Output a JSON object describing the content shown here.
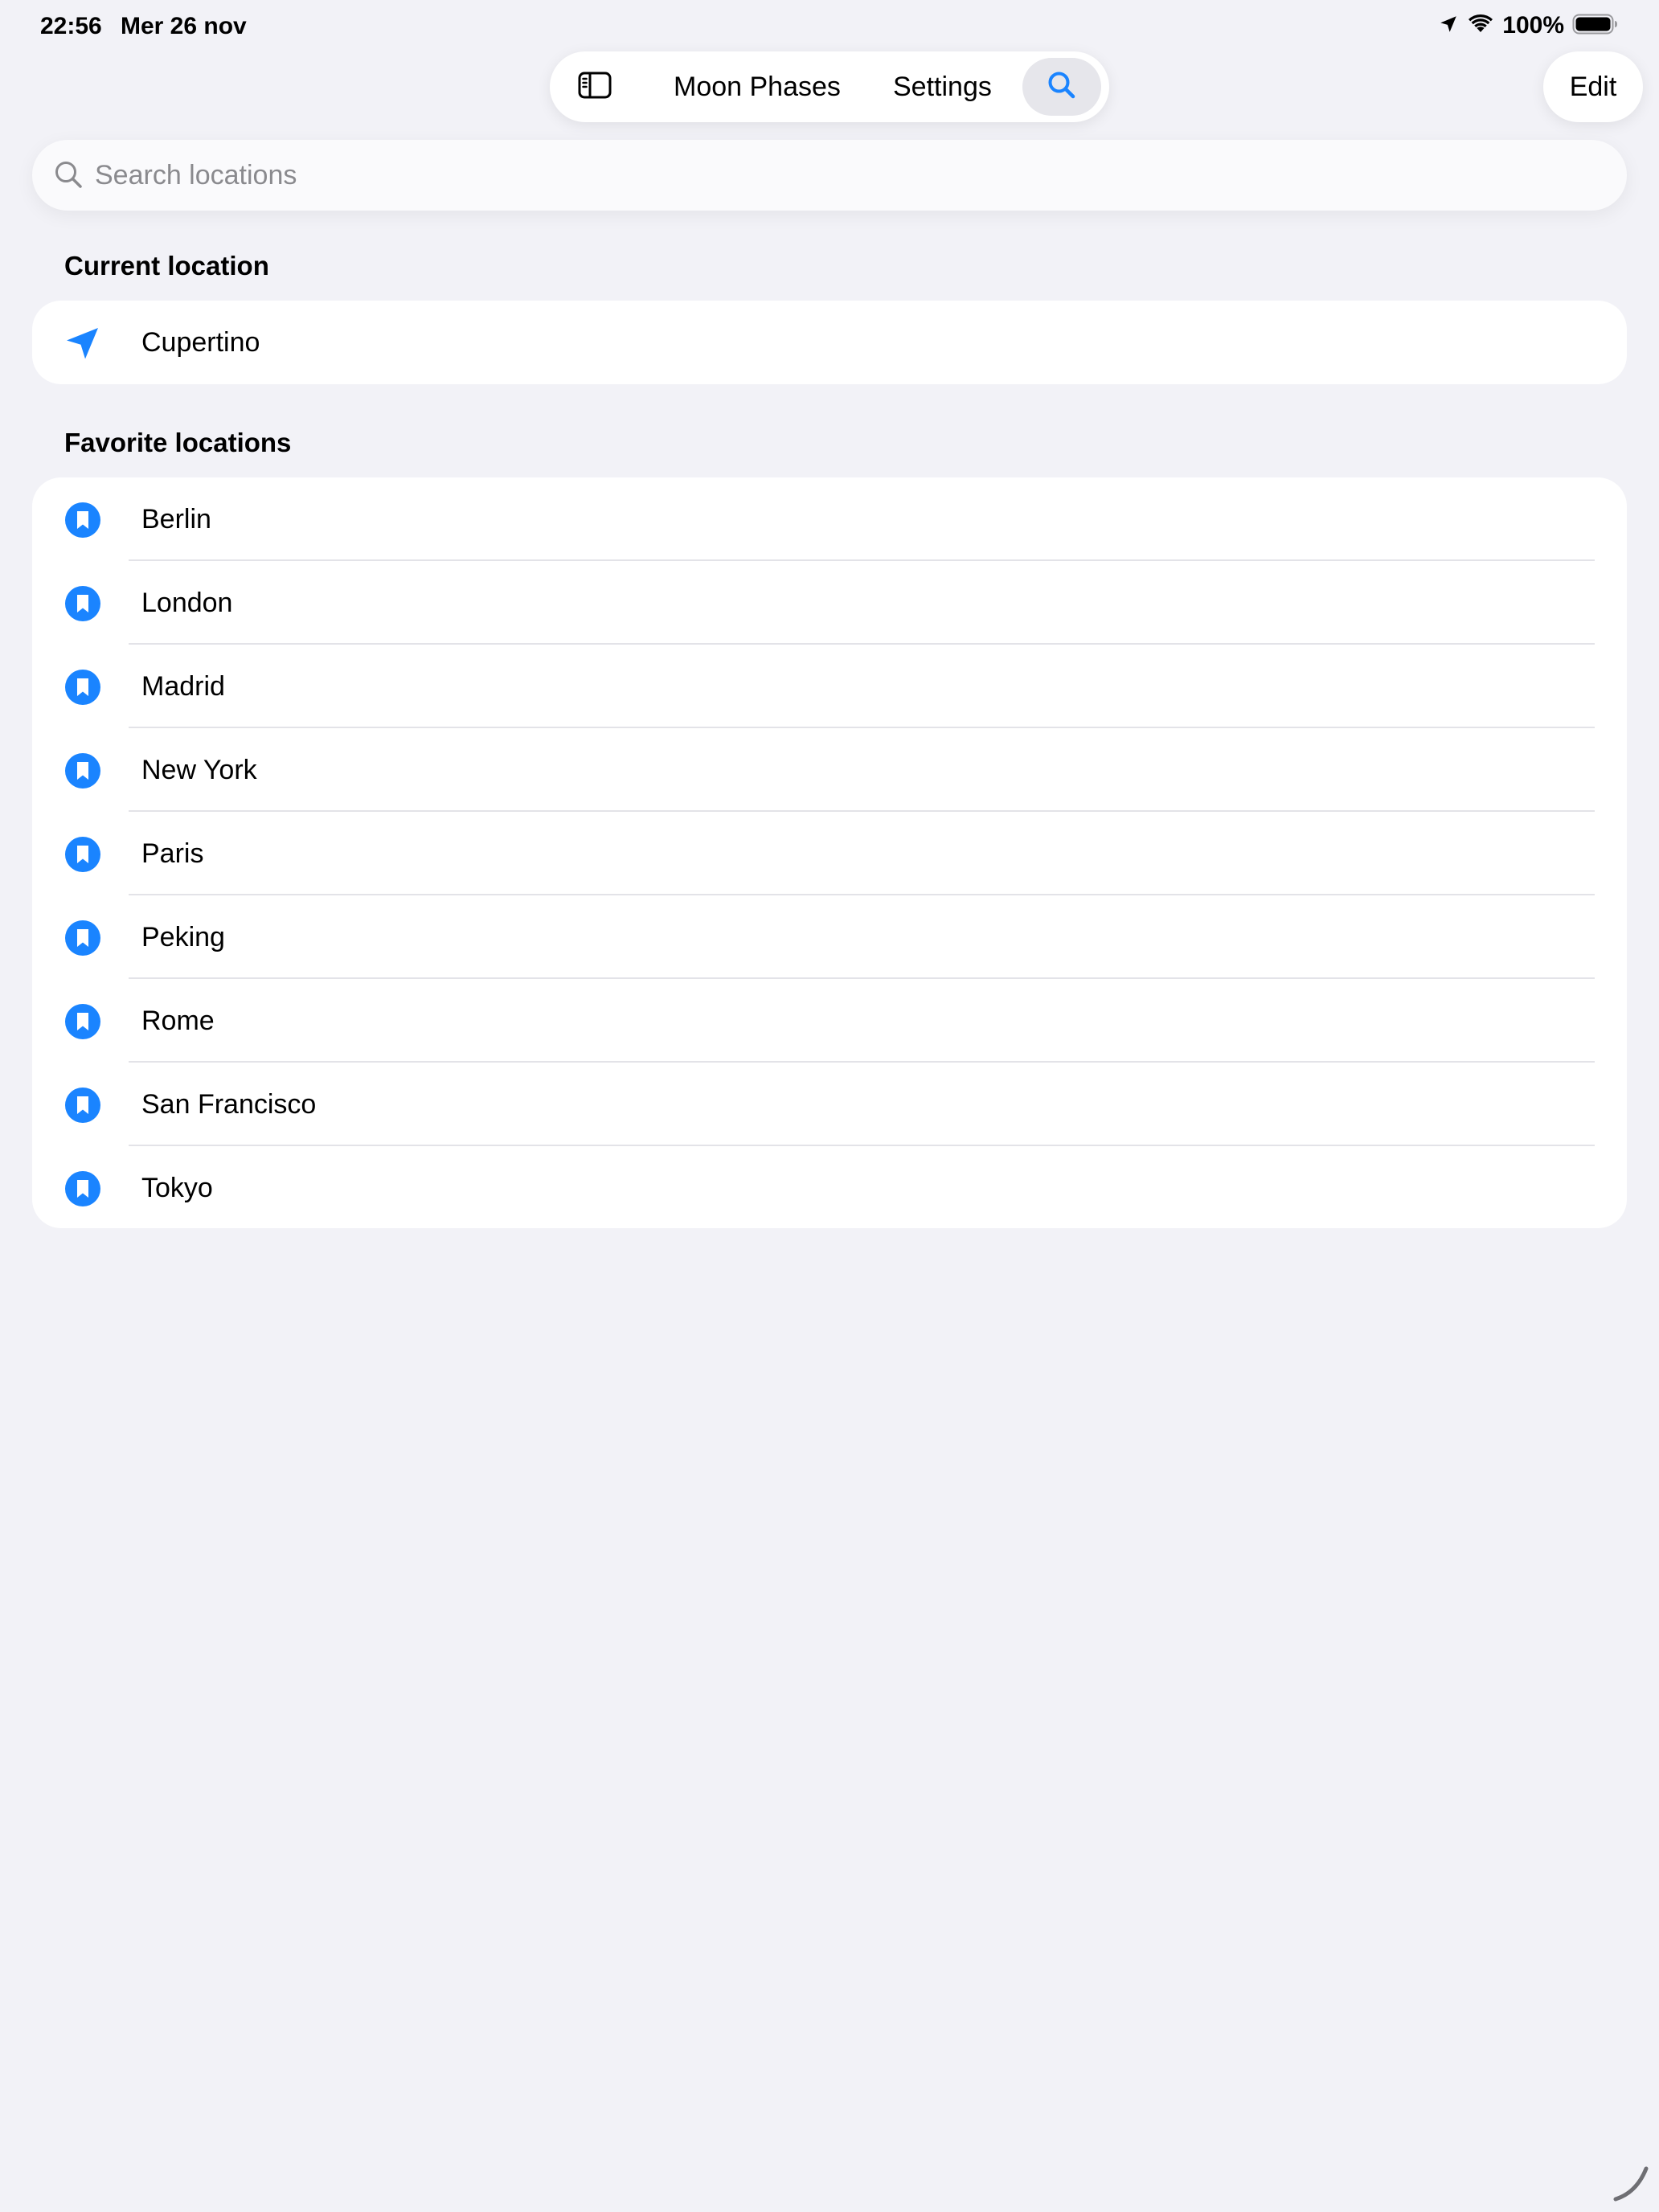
{
  "status_bar": {
    "time": "22:56",
    "date": "Mer 26 nov",
    "battery_percent": "100%",
    "icons": [
      "location-arrow-icon",
      "wifi-icon",
      "battery-icon"
    ]
  },
  "toolbar": {
    "sidebar_icon": "sidebar-toggle-icon",
    "tabs": [
      {
        "label": "Moon Phases"
      },
      {
        "label": "Settings"
      }
    ],
    "search_icon": "search-icon",
    "active_tab": "search"
  },
  "edit_button": {
    "label": "Edit"
  },
  "search": {
    "placeholder": "Search locations",
    "value": ""
  },
  "current_location": {
    "header": "Current location",
    "item": {
      "label": "Cupertino",
      "icon": "location-arrow-icon"
    }
  },
  "favorites": {
    "header": "Favorite locations",
    "icon": "bookmark-icon",
    "items": [
      {
        "label": "Berlin"
      },
      {
        "label": "London"
      },
      {
        "label": "Madrid"
      },
      {
        "label": "New York"
      },
      {
        "label": "Paris"
      },
      {
        "label": "Peking"
      },
      {
        "label": "Rome"
      },
      {
        "label": "San Francisco"
      },
      {
        "label": "Tokyo"
      }
    ]
  },
  "colors": {
    "accent": "#1a84ff",
    "background": "#f2f2f7",
    "card": "#ffffff",
    "separator": "#e3e3e8",
    "placeholder": "#8a8a8e"
  }
}
